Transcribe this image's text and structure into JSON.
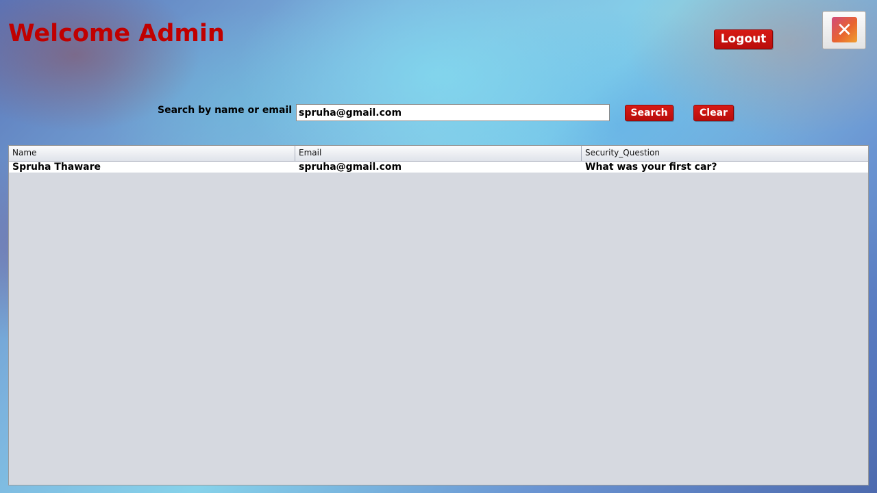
{
  "header": {
    "title": "Welcome Admin",
    "logout_label": "Logout",
    "close_icon": "close-icon",
    "close_glyph": "✕"
  },
  "search": {
    "label": "Search by name or email",
    "value": "spruha@gmail.com",
    "placeholder": "",
    "search_label": "Search",
    "clear_label": "Clear"
  },
  "table": {
    "columns": [
      "Name",
      "Email",
      "Security_Question"
    ],
    "rows": [
      [
        "Spruha Thaware",
        "spruha@gmail.com",
        "What was your first car?"
      ]
    ]
  },
  "colors": {
    "accent_red": "#c00000",
    "button_red": "#c8120f",
    "table_bg": "#d6d9e0"
  }
}
